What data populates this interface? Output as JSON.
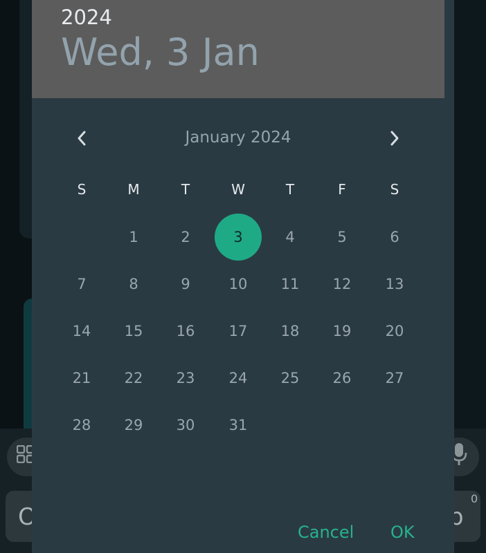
{
  "background": {
    "letters": [
      "O",
      "p"
    ],
    "superscript": "0"
  },
  "dialog": {
    "year": "2024",
    "selected_date_label": "Wed, 3 Jan",
    "month_label": "January 2024",
    "weekdays": [
      "S",
      "M",
      "T",
      "W",
      "T",
      "F",
      "S"
    ],
    "days": [
      "1",
      "2",
      "3",
      "4",
      "5",
      "6",
      "7",
      "8",
      "9",
      "10",
      "11",
      "12",
      "13",
      "14",
      "15",
      "16",
      "17",
      "18",
      "19",
      "20",
      "21",
      "22",
      "23",
      "24",
      "25",
      "26",
      "27",
      "28",
      "29",
      "30",
      "31"
    ],
    "first_weekday_index": 1,
    "selected_day": "3",
    "cancel_label": "Cancel",
    "ok_label": "OK",
    "colors": {
      "accent": "#1faa86",
      "header_bg": "#5c5c5c",
      "dialog_bg": "#2a3a43"
    },
    "icons": {
      "prev": "chevron-left-icon",
      "next": "chevron-right-icon"
    }
  }
}
